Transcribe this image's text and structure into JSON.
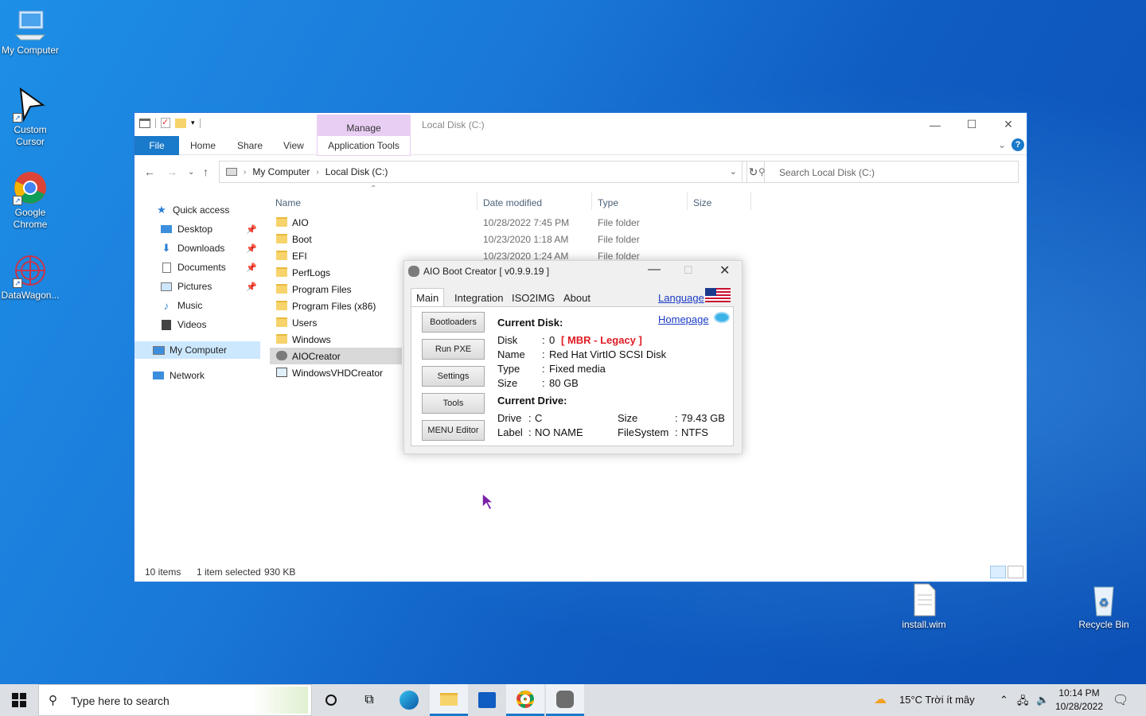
{
  "desktop": {
    "icons": [
      {
        "label": "My Computer"
      },
      {
        "label": "Custom Cursor"
      },
      {
        "label": "Google Chrome"
      },
      {
        "label": "DataWagon..."
      },
      {
        "label": "install.wim"
      },
      {
        "label": "Recycle Bin"
      }
    ]
  },
  "explorer": {
    "ribbon_context_group": "Manage",
    "window_title": "Local Disk (C:)",
    "tabs": {
      "file": "File",
      "home": "Home",
      "share": "Share",
      "view": "View",
      "app_tools": "Application Tools"
    },
    "address": {
      "crumb1": "My Computer",
      "crumb2": "Local Disk (C:)"
    },
    "search_placeholder": "Search Local Disk (C:)",
    "nav": {
      "quick_access": "Quick access",
      "desktop": "Desktop",
      "downloads": "Downloads",
      "documents": "Documents",
      "pictures": "Pictures",
      "music": "Music",
      "videos": "Videos",
      "my_computer": "My Computer",
      "network": "Network"
    },
    "columns": {
      "name": "Name",
      "date": "Date modified",
      "type": "Type",
      "size": "Size"
    },
    "files": [
      {
        "name": "AIO",
        "date": "10/28/2022 7:45 PM",
        "type": "File folder"
      },
      {
        "name": "Boot",
        "date": "10/23/2020 1:18 AM",
        "type": "File folder"
      },
      {
        "name": "EFI",
        "date": "10/23/2020 1:24 AM",
        "type": "File folder"
      },
      {
        "name": "PerfLogs",
        "date": "",
        "type": ""
      },
      {
        "name": "Program Files",
        "date": "",
        "type": ""
      },
      {
        "name": "Program Files (x86)",
        "date": "",
        "type": ""
      },
      {
        "name": "Users",
        "date": "",
        "type": ""
      },
      {
        "name": "Windows",
        "date": "",
        "type": ""
      },
      {
        "name": "AIOCreator",
        "date": "",
        "type": ""
      },
      {
        "name": "WindowsVHDCreator",
        "date": "",
        "type": ""
      }
    ],
    "status": {
      "count": "10 items",
      "selected": "1 item selected",
      "size": "930 KB"
    }
  },
  "aio": {
    "title": "AIO Boot Creator [ v0.9.9.19 ]",
    "tabs": {
      "main": "Main",
      "integration": "Integration",
      "iso2img": "ISO2IMG",
      "about": "About"
    },
    "language": "Language",
    "homepage": "Homepage",
    "buttons": {
      "bootloaders": "Bootloaders",
      "run_pxe": "Run PXE",
      "settings": "Settings",
      "tools": "Tools",
      "menu_editor": "MENU Editor"
    },
    "current_disk": {
      "heading": "Current Disk:",
      "disk_label": "Disk",
      "disk_value": "0",
      "disk_mode": "[ MBR - Legacy ]",
      "name_label": "Name",
      "name_value": "Red Hat VirtIO SCSI Disk",
      "type_label": "Type",
      "type_value": "Fixed media",
      "size_label": "Size",
      "size_value": "80 GB"
    },
    "current_drive": {
      "heading": "Current Drive:",
      "drive_label": "Drive",
      "drive_value": "C",
      "label_label": "Label",
      "label_value": "NO NAME",
      "size_label": "Size",
      "size_value": "79.43 GB",
      "fs_label": "FileSystem",
      "fs_value": "NTFS"
    }
  },
  "taskbar": {
    "search_placeholder": "Type here to search",
    "weather": "15°C  Trời ít mây",
    "time": "10:14 PM",
    "date": "10/28/2022"
  },
  "colors": {
    "accent": "#1979ca",
    "manage": "#e9cef4",
    "red": "#e01b24"
  }
}
